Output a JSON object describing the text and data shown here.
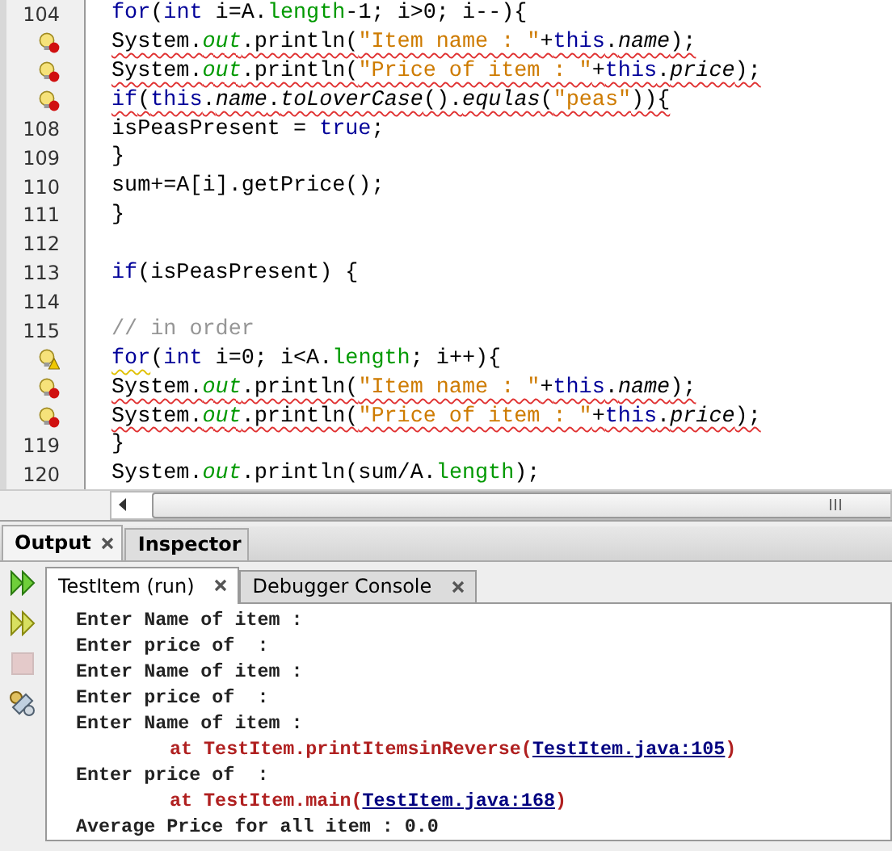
{
  "editor": {
    "lines": [
      {
        "gutter": {
          "kind": "number",
          "text": "104"
        },
        "tokens": [
          {
            "text": "for",
            "kind": "keyword"
          },
          {
            "text": "(",
            "kind": "plain"
          },
          {
            "text": "int",
            "kind": "keyword"
          },
          {
            "text": " i=A.",
            "kind": "plain"
          },
          {
            "text": "length",
            "kind": "field"
          },
          {
            "text": "-1; i>0; i--){",
            "kind": "plain"
          }
        ]
      },
      {
        "gutter": {
          "kind": "error"
        },
        "error_underline": true,
        "tokens": [
          {
            "text": "System.",
            "kind": "plain"
          },
          {
            "text": "out",
            "kind": "static"
          },
          {
            "text": ".println(",
            "kind": "plain"
          },
          {
            "text": "\"Item name : \"",
            "kind": "string"
          },
          {
            "text": "+",
            "kind": "plain"
          },
          {
            "text": "this",
            "kind": "keyword"
          },
          {
            "text": ".",
            "kind": "plain"
          },
          {
            "text": "name",
            "kind": "italic"
          },
          {
            "text": ");",
            "kind": "plain"
          }
        ]
      },
      {
        "gutter": {
          "kind": "error"
        },
        "error_underline": true,
        "tokens": [
          {
            "text": "System.",
            "kind": "plain"
          },
          {
            "text": "out",
            "kind": "static"
          },
          {
            "text": ".println(",
            "kind": "plain"
          },
          {
            "text": "\"Price of item : \"",
            "kind": "string"
          },
          {
            "text": "+",
            "kind": "plain"
          },
          {
            "text": "this",
            "kind": "keyword"
          },
          {
            "text": ".",
            "kind": "plain"
          },
          {
            "text": "price",
            "kind": "italic"
          },
          {
            "text": ");",
            "kind": "plain"
          }
        ]
      },
      {
        "gutter": {
          "kind": "error"
        },
        "error_underline": true,
        "tokens": [
          {
            "text": "if",
            "kind": "keyword"
          },
          {
            "text": "(",
            "kind": "plain"
          },
          {
            "text": "this",
            "kind": "keyword"
          },
          {
            "text": ".",
            "kind": "plain"
          },
          {
            "text": "name",
            "kind": "italic"
          },
          {
            "text": ".",
            "kind": "plain"
          },
          {
            "text": "toLoverCase",
            "kind": "italic"
          },
          {
            "text": "().",
            "kind": "plain"
          },
          {
            "text": "equlas",
            "kind": "italic"
          },
          {
            "text": "(",
            "kind": "plain"
          },
          {
            "text": "\"peas\"",
            "kind": "string"
          },
          {
            "text": ")){",
            "kind": "plain"
          }
        ]
      },
      {
        "gutter": {
          "kind": "number",
          "text": "108"
        },
        "tokens": [
          {
            "text": "isPeasPresent = ",
            "kind": "plain"
          },
          {
            "text": "true",
            "kind": "keyword"
          },
          {
            "text": ";",
            "kind": "plain"
          }
        ]
      },
      {
        "gutter": {
          "kind": "number",
          "text": "109"
        },
        "tokens": [
          {
            "text": "}",
            "kind": "plain"
          }
        ]
      },
      {
        "gutter": {
          "kind": "number",
          "text": "110"
        },
        "tokens": [
          {
            "text": "sum+=A[i].getPrice();",
            "kind": "plain"
          }
        ]
      },
      {
        "gutter": {
          "kind": "number",
          "text": "111"
        },
        "tokens": [
          {
            "text": "}",
            "kind": "plain"
          }
        ]
      },
      {
        "gutter": {
          "kind": "number",
          "text": "112"
        }
      },
      {
        "gutter": {
          "kind": "number",
          "text": "113"
        },
        "tokens": [
          {
            "text": "if",
            "kind": "keyword"
          },
          {
            "text": "(isPeasPresent) {",
            "kind": "plain"
          }
        ]
      },
      {
        "gutter": {
          "kind": "number",
          "text": "114"
        }
      },
      {
        "gutter": {
          "kind": "number",
          "text": "115"
        },
        "tokens": [
          {
            "text": "// in order",
            "kind": "comment"
          }
        ]
      },
      {
        "gutter": {
          "kind": "warning"
        },
        "tokens": [
          {
            "text": "for",
            "kind": "keyword",
            "warning_underline": true
          },
          {
            "text": "(",
            "kind": "plain"
          },
          {
            "text": "int",
            "kind": "keyword"
          },
          {
            "text": " i=0; i<A.",
            "kind": "plain"
          },
          {
            "text": "length",
            "kind": "field"
          },
          {
            "text": "; i++){",
            "kind": "plain"
          }
        ]
      },
      {
        "gutter": {
          "kind": "error"
        },
        "error_underline": true,
        "tokens": [
          {
            "text": "System.",
            "kind": "plain"
          },
          {
            "text": "out",
            "kind": "static"
          },
          {
            "text": ".println(",
            "kind": "plain"
          },
          {
            "text": "\"Item name : \"",
            "kind": "string"
          },
          {
            "text": "+",
            "kind": "plain"
          },
          {
            "text": "this",
            "kind": "keyword"
          },
          {
            "text": ".",
            "kind": "plain"
          },
          {
            "text": "name",
            "kind": "italic"
          },
          {
            "text": ");",
            "kind": "plain"
          }
        ]
      },
      {
        "gutter": {
          "kind": "error"
        },
        "error_underline": true,
        "tokens": [
          {
            "text": "System.",
            "kind": "plain"
          },
          {
            "text": "out",
            "kind": "static"
          },
          {
            "text": ".println(",
            "kind": "plain"
          },
          {
            "text": "\"Price of item : \"",
            "kind": "string"
          },
          {
            "text": "+",
            "kind": "plain"
          },
          {
            "text": "this",
            "kind": "keyword"
          },
          {
            "text": ".",
            "kind": "plain"
          },
          {
            "text": "price",
            "kind": "italic"
          },
          {
            "text": ");",
            "kind": "plain"
          }
        ]
      },
      {
        "gutter": {
          "kind": "number",
          "text": "119"
        },
        "tokens": [
          {
            "text": "}",
            "kind": "plain"
          }
        ]
      },
      {
        "gutter": {
          "kind": "number",
          "text": "120"
        },
        "tokens": [
          {
            "text": "System.",
            "kind": "plain"
          },
          {
            "text": "out",
            "kind": "static"
          },
          {
            "text": ".println(sum/A.",
            "kind": "plain"
          },
          {
            "text": "length",
            "kind": "field"
          },
          {
            "text": ");",
            "kind": "plain"
          }
        ]
      }
    ]
  },
  "panel_tabs": [
    {
      "label": "Output",
      "selected": true
    },
    {
      "label": "Inspector",
      "selected": false
    }
  ],
  "output_toolbar": [
    {
      "kind": "rerun",
      "disabled": false
    },
    {
      "kind": "rerun-options",
      "disabled": false
    },
    {
      "kind": "stop",
      "disabled": true
    },
    {
      "kind": "settings",
      "disabled": false
    }
  ],
  "console_tabs": [
    {
      "label": "TestItem (run)",
      "selected": true
    },
    {
      "label": "Debugger Console",
      "selected": false
    }
  ],
  "console_lines": [
    {
      "kind": "text",
      "text": "Enter Name of item :"
    },
    {
      "kind": "text",
      "text": "Enter price of  :"
    },
    {
      "kind": "text",
      "text": "Enter Name of item :"
    },
    {
      "kind": "text",
      "text": "Enter price of  :"
    },
    {
      "kind": "text",
      "text": "Enter Name of item :"
    },
    {
      "kind": "trace",
      "text": "at TestItem.printItemsinReverse(",
      "link": "TestItem.java:105",
      "end": ")"
    },
    {
      "kind": "text",
      "text": "Enter price of  :"
    },
    {
      "kind": "trace",
      "text": "at TestItem.main(",
      "link": "TestItem.java:168",
      "end": ")"
    },
    {
      "kind": "text",
      "text": "Average Price for all item : 0.0"
    }
  ]
}
